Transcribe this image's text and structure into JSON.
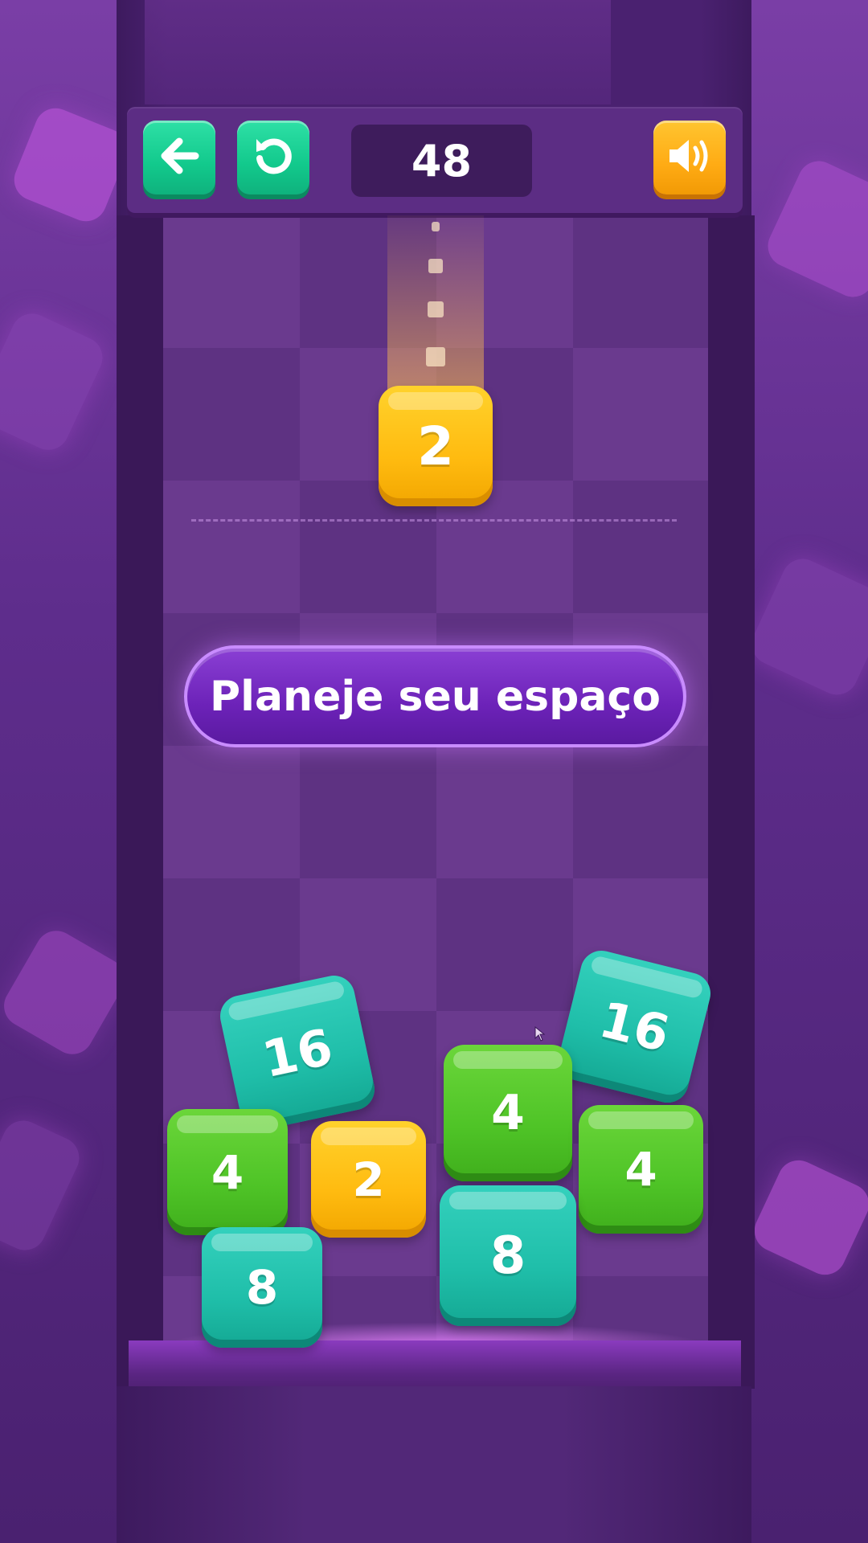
{
  "header": {
    "back_icon": "arrow-left-icon",
    "restart_icon": "restart-icon",
    "score": "48",
    "sound_icon": "speaker-volume-icon"
  },
  "current_tile": {
    "value": "2",
    "color": "#ffbb10"
  },
  "banner": {
    "text": "Planeje seu espaço"
  },
  "tiles": [
    {
      "value": "16",
      "color": "teal"
    },
    {
      "value": "16",
      "color": "teal"
    },
    {
      "value": "4",
      "color": "green"
    },
    {
      "value": "2",
      "color": "yellow"
    },
    {
      "value": "4",
      "color": "green"
    },
    {
      "value": "4",
      "color": "green"
    },
    {
      "value": "8",
      "color": "teal"
    },
    {
      "value": "8",
      "color": "teal"
    }
  ],
  "colors": {
    "green": "#4fc427",
    "teal": "#1fbea9",
    "yellow": "#ffbb10",
    "button_green": "#12c98c",
    "button_orange": "#ffab14",
    "background": "#4a2170"
  }
}
